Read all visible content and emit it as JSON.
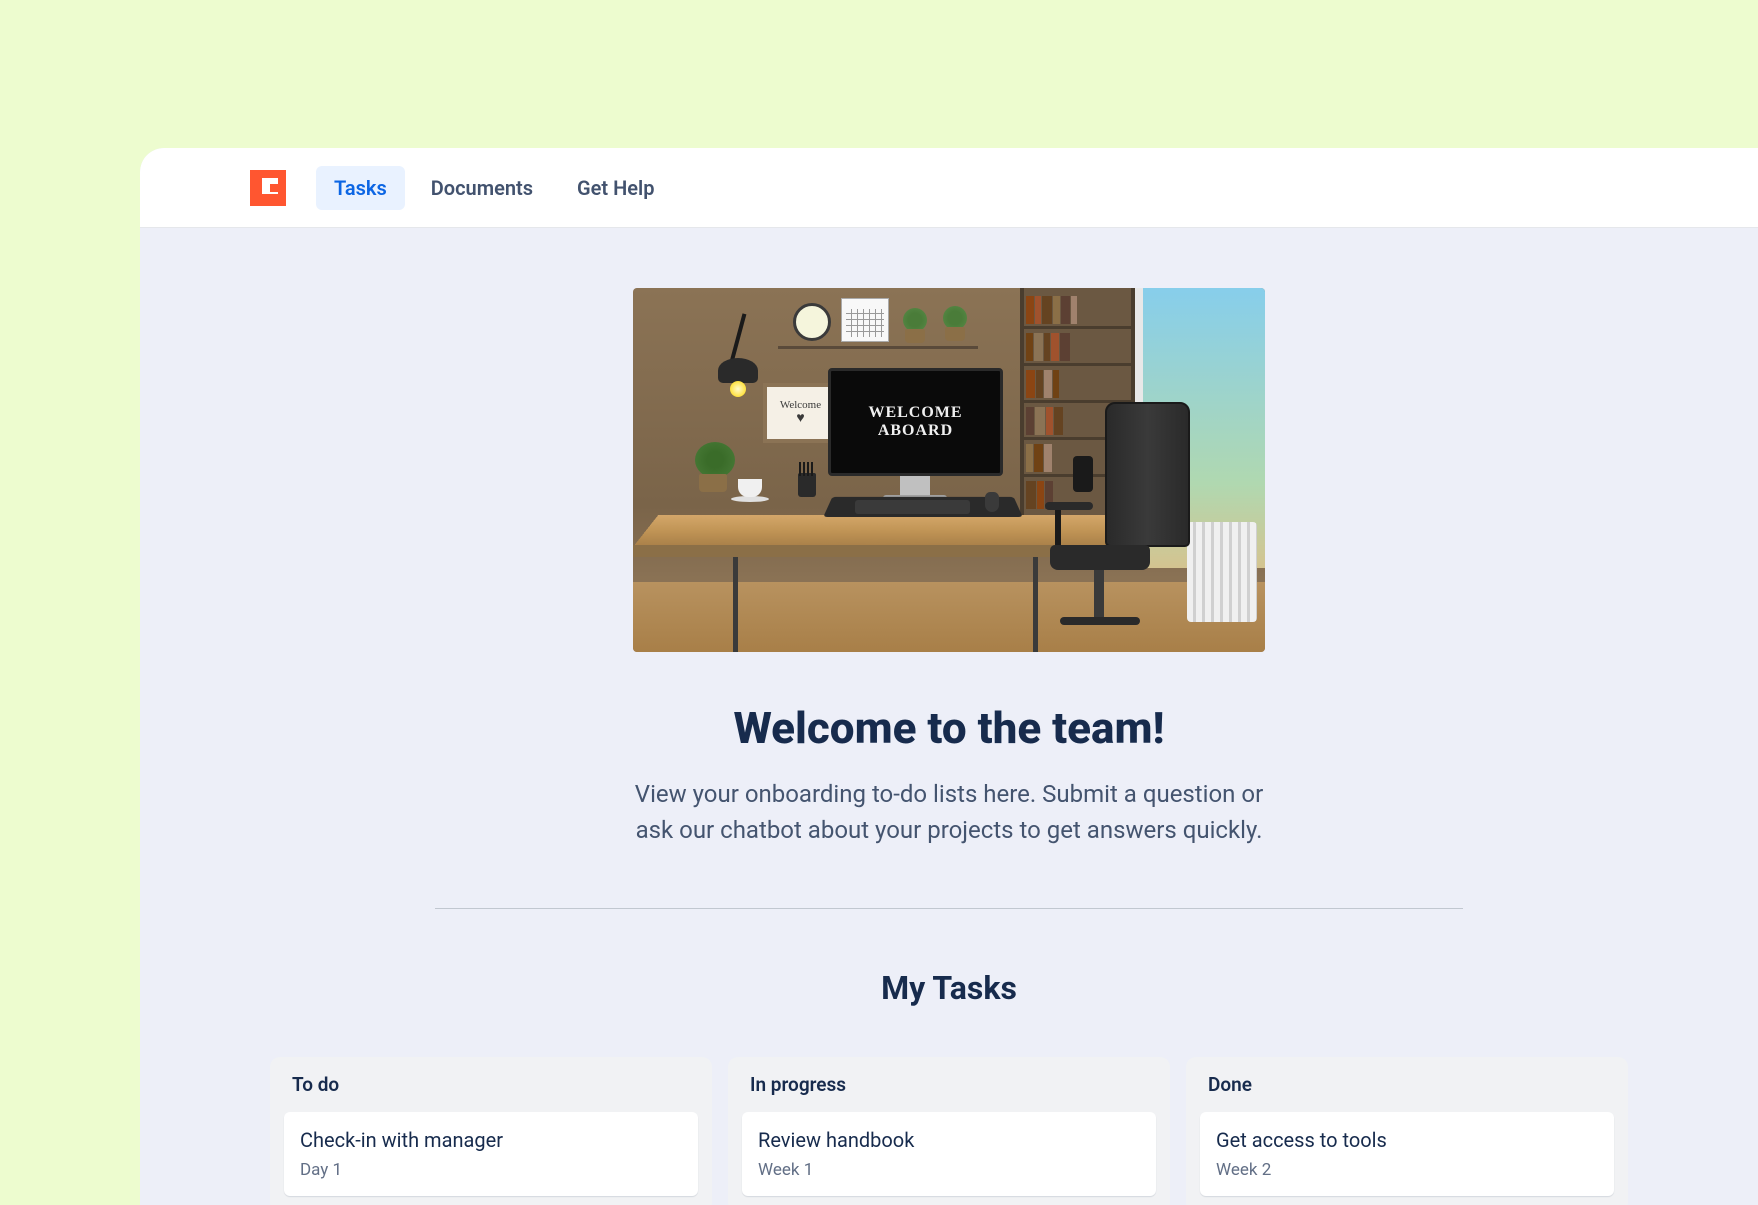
{
  "nav": {
    "tabs": [
      {
        "label": "Tasks",
        "active": true
      },
      {
        "label": "Documents",
        "active": false
      },
      {
        "label": "Get Help",
        "active": false
      }
    ]
  },
  "hero": {
    "image_text_line1": "WELCOME",
    "image_text_line2": "ABOARD",
    "frame_text": "Welcome",
    "title": "Welcome to the team!",
    "subtitle": "View your onboarding to-do lists here. Submit a question or ask our chatbot about your projects to get answers quickly."
  },
  "tasks": {
    "section_title": "My Tasks",
    "columns": [
      {
        "name": "To do",
        "cards": [
          {
            "title": "Check-in with manager",
            "meta": "Day 1"
          }
        ]
      },
      {
        "name": "In progress",
        "cards": [
          {
            "title": "Review handbook",
            "meta": "Week 1"
          }
        ]
      },
      {
        "name": "Done",
        "cards": [
          {
            "title": "Get access to tools",
            "meta": "Week 2"
          }
        ]
      }
    ]
  }
}
